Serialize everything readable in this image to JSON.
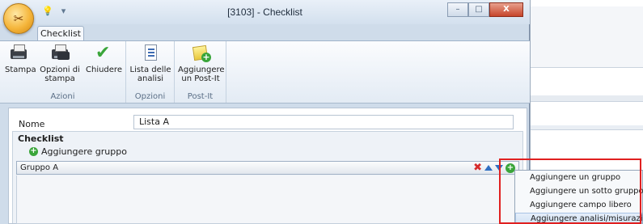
{
  "window": {
    "title": "[3103] - Checklist",
    "minimize": "–",
    "maximize": "□",
    "close": "X"
  },
  "ribbon": {
    "tab": "Checklist",
    "groups": [
      {
        "label": "Azioni",
        "buttons": [
          {
            "label": "Stampa",
            "icon": "printer-icon"
          },
          {
            "label": "Opzioni di stampa",
            "icon": "print-options-icon"
          },
          {
            "label": "Chiudere",
            "icon": "checkmark-icon"
          }
        ]
      },
      {
        "label": "Opzioni",
        "buttons": [
          {
            "label": "Lista delle analisi",
            "icon": "list-document-icon"
          }
        ]
      },
      {
        "label": "Post-It",
        "buttons": [
          {
            "label": "Aggiungere un Post-It",
            "icon": "postit-add-icon"
          }
        ]
      }
    ]
  },
  "form": {
    "name_label": "Nome",
    "name_value": "Lista A",
    "checklist_title": "Checklist",
    "add_group": "Aggiungere gruppo",
    "group_name": "Gruppo A"
  },
  "context_menu": {
    "items": [
      "Aggiungere un gruppo",
      "Aggiungere un sotto gruppo",
      "Aggiungere campo libero",
      "Aggiungere analisi/misurazione"
    ],
    "highlighted_index": 3
  },
  "colors": {
    "accent_green": "#3aa53a",
    "delete_red": "#d62b2b",
    "arrow_blue": "#2f6fc3",
    "annotation_red": "#e02020"
  }
}
